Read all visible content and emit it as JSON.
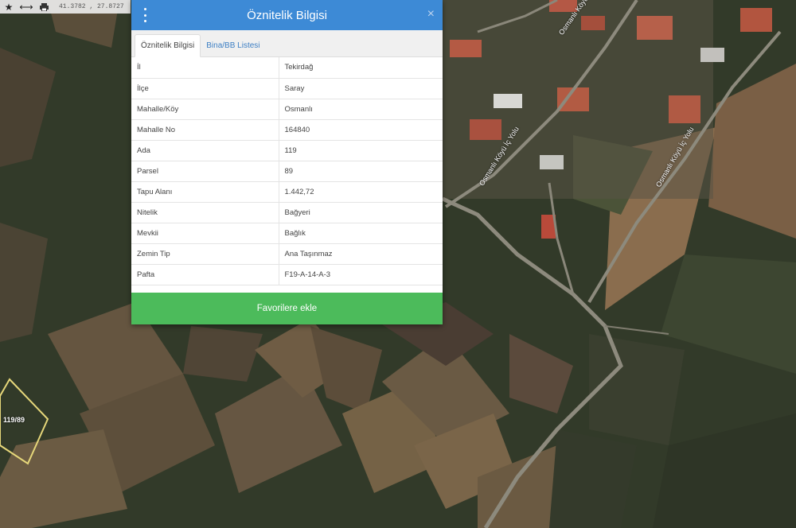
{
  "toolbar": {
    "coords": "41.3782 , 27.8727",
    "icons": [
      "star-icon",
      "measure-icon",
      "print-icon"
    ]
  },
  "panel": {
    "title": "Öznitelik Bilgisi",
    "close_glyph": "×",
    "tabs": [
      {
        "label": "Öznitelik Bilgisi",
        "active": true
      },
      {
        "label": "Bina/BB Listesi",
        "active": false
      }
    ],
    "rows": [
      {
        "key": "İl",
        "value": "Tekirdağ"
      },
      {
        "key": "İlçe",
        "value": "Saray"
      },
      {
        "key": "Mahalle/Köy",
        "value": "Osmanlı"
      },
      {
        "key": "Mahalle No",
        "value": "164840"
      },
      {
        "key": "Ada",
        "value": "119"
      },
      {
        "key": "Parsel",
        "value": "89"
      },
      {
        "key": "Tapu Alanı",
        "value": "1.442,72"
      },
      {
        "key": "Nitelik",
        "value": "Bağyeri"
      },
      {
        "key": "Mevkii",
        "value": "Bağlık"
      },
      {
        "key": "Zemin Tip",
        "value": "Ana Taşınmaz"
      },
      {
        "key": "Pafta",
        "value": "F19-A-14-A-3"
      }
    ],
    "favorite_button": "Favorilere ekle"
  },
  "map": {
    "parcel_label": "119/89",
    "road_labels": [
      "Osmanlı Köyü İç Yolu",
      "Osmanlı Köyü İç Yolu",
      "Osmanlı Köyü İç Yolu"
    ],
    "colors": {
      "header": "#3d8ad6",
      "button": "#4cbb5b",
      "parcel_outline": "#e6d77a"
    }
  }
}
